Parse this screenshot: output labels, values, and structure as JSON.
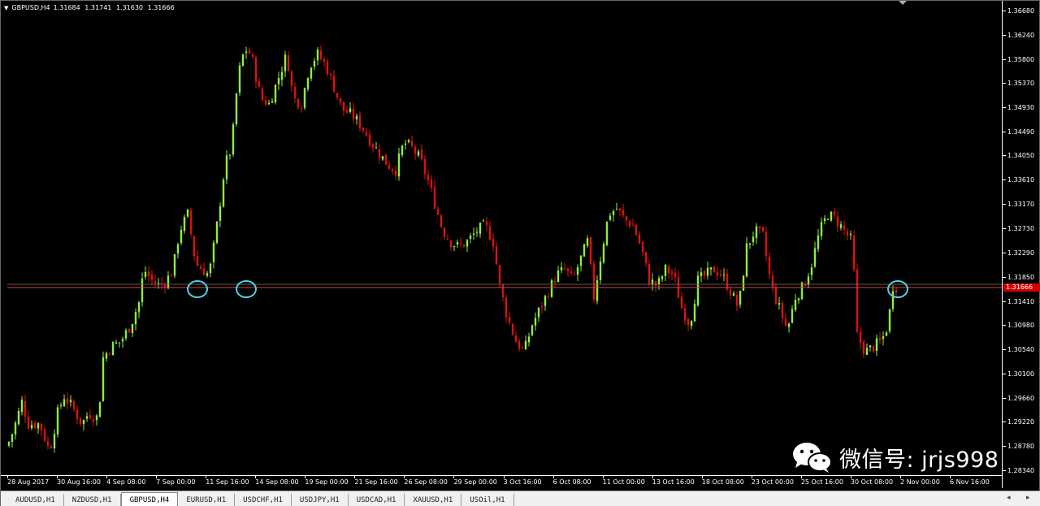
{
  "window": {
    "symbol": "GBPUSD,H4",
    "ohlc": [
      "1.31684",
      "1.31741",
      "1.31630",
      "1.31666"
    ],
    "current_price": "1.31666"
  },
  "y_axis": {
    "labels": [
      "1.36680",
      "1.36240",
      "1.35800",
      "1.35370",
      "1.34930",
      "1.34490",
      "1.34050",
      "1.33610",
      "1.33170",
      "1.32730",
      "1.32290",
      "1.31850",
      "1.31410",
      "1.30980",
      "1.30540",
      "1.30100",
      "1.29660",
      "1.29220",
      "1.28780",
      "1.28340"
    ]
  },
  "x_axis": {
    "labels": [
      "28 Aug 2017",
      "30 Aug 16:00",
      "4 Sep 08:00",
      "7 Sep 00:00",
      "11 Sep 16:00",
      "14 Sep 08:00",
      "19 Sep 00:00",
      "21 Sep 16:00",
      "26 Sep 08:00",
      "29 Sep 00:00",
      "3 Oct 16:00",
      "6 Oct 08:00",
      "11 Oct 00:00",
      "13 Oct 16:00",
      "18 Oct 08:00",
      "23 Oct 00:00",
      "25 Oct 16:00",
      "30 Oct 08:00",
      "2 Nov 00:00",
      "6 Nov 16:00"
    ]
  },
  "tabs": [
    {
      "label": "AUDUSD,H1",
      "active": false
    },
    {
      "label": "NZDUSD,H1",
      "active": false
    },
    {
      "label": "GBPUSD,H4",
      "active": true
    },
    {
      "label": "EURUSD,H1",
      "active": false
    },
    {
      "label": "USDCHF,H1",
      "active": false
    },
    {
      "label": "USDJPY,H1",
      "active": false
    },
    {
      "label": "USDCAD,H1",
      "active": false
    },
    {
      "label": "XAUUSD,H1",
      "active": false
    },
    {
      "label": "USOil,H1",
      "active": false
    }
  ],
  "watermark": {
    "text": "微信号: jrjs998",
    "icon": "wechat-icon"
  },
  "colors": {
    "bull": "#90ee40",
    "bear": "#e01010",
    "support_line": "#d24040",
    "circle": "#4fd2e6",
    "background": "#000000"
  },
  "chart_data": {
    "type": "candlestick",
    "symbol": "GBPUSD",
    "timeframe": "H4",
    "ylim": [
      1.2827,
      1.3675
    ],
    "support_level": 1.3167,
    "path_points": [
      [
        0,
        1.288
      ],
      [
        8,
        1.291
      ],
      [
        18,
        1.296
      ],
      [
        26,
        1.292
      ],
      [
        40,
        1.292
      ],
      [
        52,
        1.287
      ],
      [
        62,
        1.294
      ],
      [
        70,
        1.297
      ],
      [
        80,
        1.295
      ],
      [
        92,
        1.292
      ],
      [
        100,
        1.294
      ],
      [
        112,
        1.293
      ],
      [
        118,
        1.304
      ],
      [
        128,
        1.306
      ],
      [
        140,
        1.307
      ],
      [
        152,
        1.31
      ],
      [
        162,
        1.314
      ],
      [
        168,
        1.32
      ],
      [
        178,
        1.318
      ],
      [
        188,
        1.317
      ],
      [
        196,
        1.318
      ],
      [
        204,
        1.32
      ],
      [
        212,
        1.327
      ],
      [
        222,
        1.33
      ],
      [
        232,
        1.321
      ],
      [
        240,
        1.32
      ],
      [
        248,
        1.319
      ],
      [
        252,
        1.322
      ],
      [
        260,
        1.33
      ],
      [
        268,
        1.339
      ],
      [
        276,
        1.342
      ],
      [
        284,
        1.355
      ],
      [
        292,
        1.36
      ],
      [
        300,
        1.359
      ],
      [
        312,
        1.351
      ],
      [
        322,
        1.35
      ],
      [
        332,
        1.354
      ],
      [
        344,
        1.359
      ],
      [
        352,
        1.351
      ],
      [
        362,
        1.35
      ],
      [
        372,
        1.357
      ],
      [
        382,
        1.359
      ],
      [
        392,
        1.357
      ],
      [
        402,
        1.353
      ],
      [
        412,
        1.349
      ],
      [
        424,
        1.348
      ],
      [
        436,
        1.346
      ],
      [
        448,
        1.343
      ],
      [
        458,
        1.341
      ],
      [
        468,
        1.339
      ],
      [
        478,
        1.338
      ],
      [
        488,
        1.343
      ],
      [
        498,
        1.342
      ],
      [
        508,
        1.34
      ],
      [
        518,
        1.336
      ],
      [
        528,
        1.331
      ],
      [
        536,
        1.327
      ],
      [
        546,
        1.325
      ],
      [
        556,
        1.324
      ],
      [
        566,
        1.325
      ],
      [
        578,
        1.327
      ],
      [
        588,
        1.328
      ],
      [
        598,
        1.325
      ],
      [
        606,
        1.317
      ],
      [
        616,
        1.311
      ],
      [
        626,
        1.307
      ],
      [
        636,
        1.305
      ],
      [
        646,
        1.31
      ],
      [
        656,
        1.313
      ],
      [
        666,
        1.316
      ],
      [
        676,
        1.319
      ],
      [
        686,
        1.32
      ],
      [
        696,
        1.318
      ],
      [
        706,
        1.322
      ],
      [
        714,
        1.325
      ],
      [
        722,
        1.315
      ],
      [
        730,
        1.322
      ],
      [
        740,
        1.33
      ],
      [
        750,
        1.331
      ],
      [
        760,
        1.329
      ],
      [
        770,
        1.328
      ],
      [
        780,
        1.324
      ],
      [
        790,
        1.318
      ],
      [
        800,
        1.317
      ],
      [
        810,
        1.32
      ],
      [
        820,
        1.319
      ],
      [
        830,
        1.313
      ],
      [
        840,
        1.31
      ],
      [
        850,
        1.318
      ],
      [
        860,
        1.319
      ],
      [
        870,
        1.32
      ],
      [
        880,
        1.319
      ],
      [
        890,
        1.316
      ],
      [
        900,
        1.313
      ],
      [
        910,
        1.324
      ],
      [
        920,
        1.327
      ],
      [
        930,
        1.326
      ],
      [
        940,
        1.317
      ],
      [
        950,
        1.313
      ],
      [
        960,
        1.309
      ],
      [
        970,
        1.315
      ],
      [
        980,
        1.317
      ],
      [
        990,
        1.321
      ],
      [
        1000,
        1.327
      ],
      [
        1010,
        1.33
      ],
      [
        1020,
        1.329
      ],
      [
        1030,
        1.327
      ],
      [
        1040,
        1.325
      ],
      [
        1046,
        1.308
      ],
      [
        1056,
        1.305
      ],
      [
        1066,
        1.306
      ],
      [
        1076,
        1.307
      ],
      [
        1084,
        1.31
      ],
      [
        1090,
        1.317
      ],
      [
        1096,
        1.3167
      ]
    ]
  }
}
